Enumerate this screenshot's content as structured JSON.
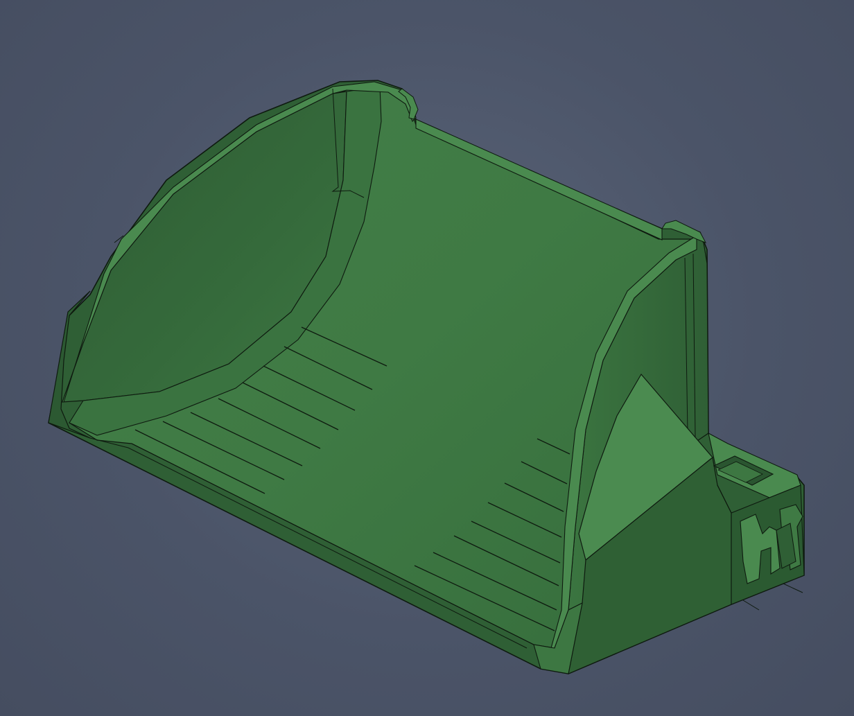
{
  "viewport": {
    "background_color": "#4b5468"
  },
  "model": {
    "body_color": "#3f7a44",
    "light_color": "#4a8a4f",
    "shade_color": "#2f5f35",
    "dark_color": "#284f2d",
    "edge_color": "#0e1a0f"
  }
}
